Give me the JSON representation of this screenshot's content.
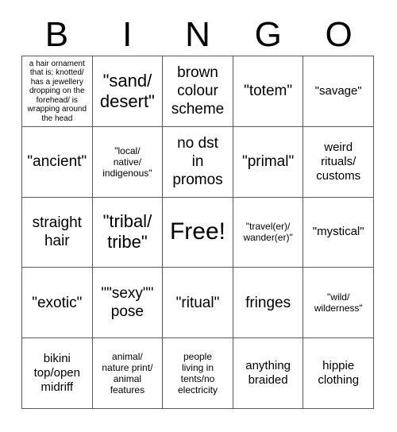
{
  "card": {
    "title": "BINGO",
    "headers": [
      "B",
      "I",
      "N",
      "G",
      "O"
    ],
    "free_space": "Free!",
    "border_color": "#5a5a5a",
    "text_color": "#000000",
    "background_color": "#ffffff",
    "rows": [
      [
        "a hair ornament that is; knotted/ has a jewellery dropping on the forehead/ is wrapping around the head",
        "\"sand/\ndesert\"",
        "brown\ncolour\nscheme",
        "\"totem\"",
        "\"savage\""
      ],
      [
        "\"ancient\"",
        "\"local/\nnative/\nindigenous\"",
        "no dst\nin\npromos",
        "\"primal\"",
        "weird\nrituals/\ncustoms"
      ],
      [
        "straight\nhair",
        "\"tribal/\ntribe\"",
        "Free!",
        "\"travel(er)/\nwander(er)\"",
        "\"mystical\""
      ],
      [
        "\"exotic\"",
        "\"\"sexy\"\"\npose",
        "\"ritual\"",
        "fringes",
        "\"wild/\nwilderness\""
      ],
      [
        "bikini\ntop/open\nmidriff",
        "animal/\nnature print/\nanimal\nfeatures",
        "people\nliving in\ntents/no\nelectricity",
        "anything\nbraided",
        "hippie\nclothing"
      ]
    ]
  }
}
